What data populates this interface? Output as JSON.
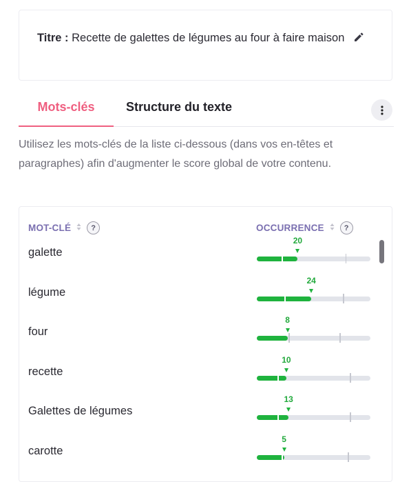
{
  "title": {
    "label": "Titre :",
    "text": " Recette de galettes de légumes au four à faire maison",
    "edit_icon": "pencil-icon"
  },
  "tabs": {
    "keywords": "Mots-clés",
    "structure": "Structure du texte",
    "more_icon": "kebab-menu-icon"
  },
  "description": "Utilisez les mots-clés de la liste ci-dessous (dans vos en-têtes et paragraphes) afin d'augmenter le score global de votre contenu.",
  "table": {
    "col_keyword": "MOT-CLÉ",
    "col_occurrence": "OCCURRENCE",
    "help": "?",
    "sort_icon": "sort-arrows-icon",
    "rows": [
      {
        "keyword": "galette",
        "count": "20",
        "fill": 0.36,
        "marker": 0.36,
        "t1": 0.22,
        "t2": 0.78
      },
      {
        "keyword": "légume",
        "count": "24",
        "fill": 0.48,
        "marker": 0.48,
        "t1": 0.24,
        "t2": 0.76
      },
      {
        "keyword": "four",
        "count": "8",
        "fill": 0.27,
        "marker": 0.27,
        "t1": 0.28,
        "t2": 0.73
      },
      {
        "keyword": "recette",
        "count": "10",
        "fill": 0.26,
        "marker": 0.26,
        "t1": 0.18,
        "t2": 0.82
      },
      {
        "keyword": "Galettes de légumes",
        "count": "13",
        "fill": 0.28,
        "marker": 0.28,
        "t1": 0.18,
        "t2": 0.82
      },
      {
        "keyword": "carotte",
        "count": "5",
        "fill": 0.24,
        "marker": 0.24,
        "t1": 0.22,
        "t2": 0.8
      }
    ]
  },
  "colors": {
    "accent": "#ef5f80",
    "good": "#1fb33e",
    "header": "#7a6fb0"
  }
}
